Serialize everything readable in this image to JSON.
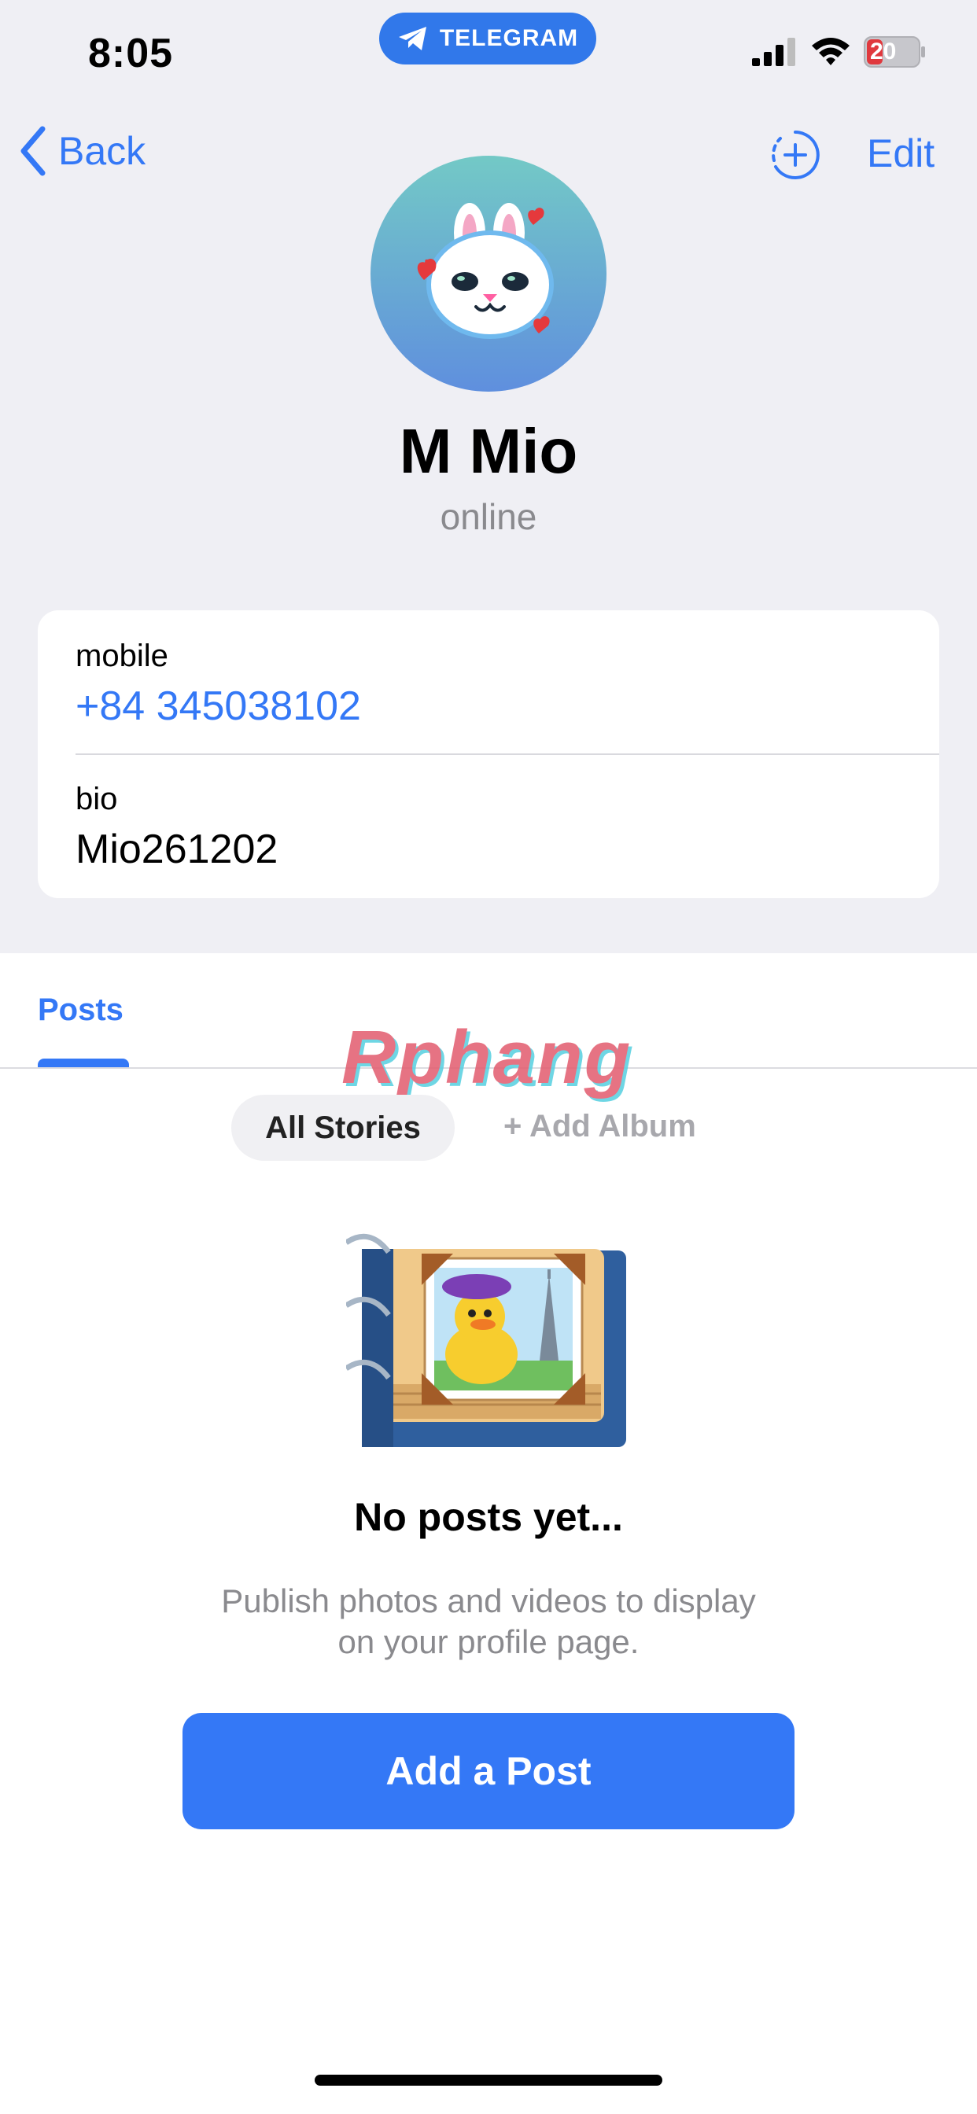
{
  "status_bar": {
    "time": "8:05",
    "app_pill_label": "TELEGRAM",
    "battery_level": "20",
    "icons": [
      "signal-icon",
      "wifi-icon",
      "battery-charging-icon",
      "telegram-plane-icon"
    ]
  },
  "nav": {
    "back_label": "Back",
    "edit_label": "Edit",
    "icons": [
      "chevron-left-icon",
      "add-story-icon"
    ]
  },
  "profile": {
    "name": "M Mio",
    "status": "online",
    "avatar_icon": "bunny-sticker-avatar"
  },
  "info": {
    "mobile_label": "mobile",
    "mobile_value": "+84 345038102",
    "bio_label": "bio",
    "bio_value": "Mio261202"
  },
  "tabs": [
    {
      "label": "Posts",
      "active": true
    }
  ],
  "watermark_text": "Rphang",
  "filters": {
    "all_stories": "All Stories",
    "add_album": "+ Add Album"
  },
  "empty_state": {
    "title": "No posts yet...",
    "text": "Publish photos and videos to display on your profile page.",
    "button_label": "Add a Post",
    "illustration_icon": "photo-album-duck-icon"
  },
  "colors": {
    "accent": "#3478f6",
    "telegram_pill": "#3178ea",
    "background": "#efeff4",
    "secondary_text": "#8a8a8e",
    "battery_low": "#e0393e"
  }
}
